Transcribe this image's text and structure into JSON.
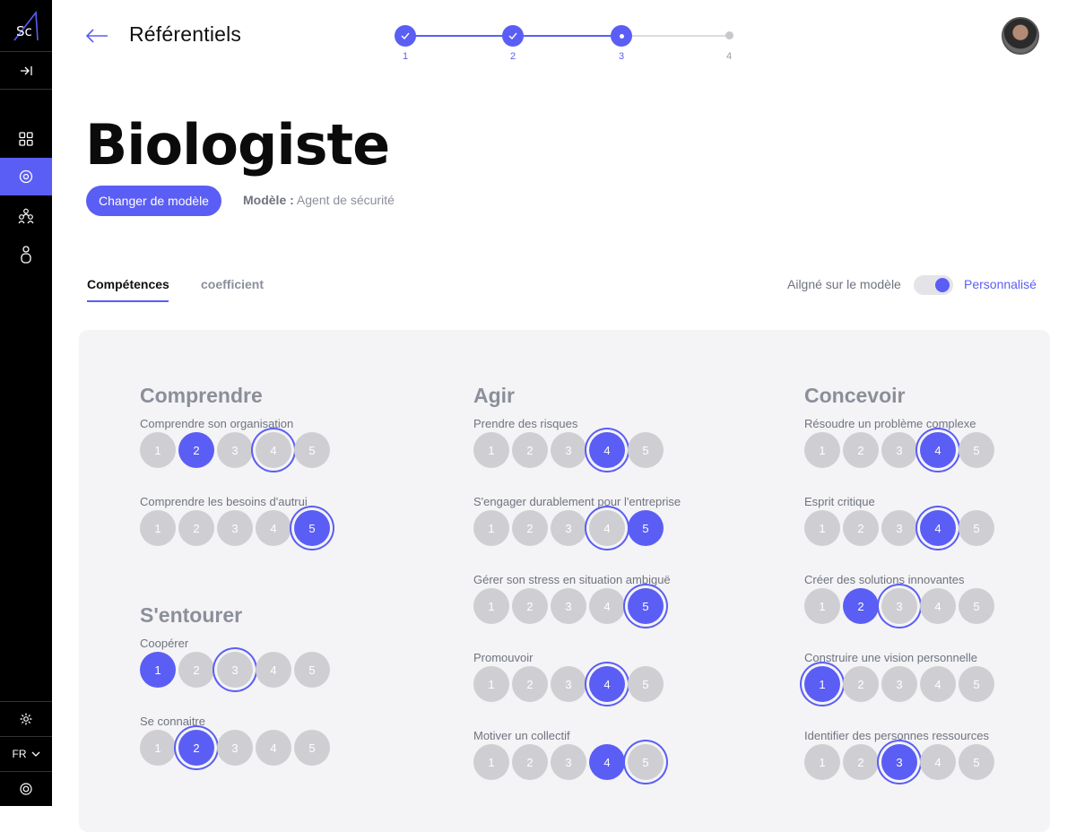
{
  "sidebar": {
    "logo": "Sc",
    "lang": "FR"
  },
  "header": {
    "title": "Référentiels"
  },
  "stepper": {
    "steps": [
      "1",
      "2",
      "3",
      "4"
    ]
  },
  "page": {
    "job_title": "Biologiste",
    "change_button": "Changer de modèle",
    "model_label": "Modèle :",
    "model_value": "Agent de sécurité"
  },
  "tabs": {
    "competences": "Compétences",
    "coefficient": "coefficient"
  },
  "alignment": {
    "left_label": "Ailgné sur le modèle",
    "right_label": "Personnalisé",
    "toggle_on": true
  },
  "colors": {
    "accent": "#5b5ef4",
    "inactive": "#cfcfd3",
    "panel": "#f4f4f6"
  },
  "rating_scale": [
    "1",
    "2",
    "3",
    "4",
    "5"
  ],
  "columns": [
    {
      "title": "Comprendre",
      "skills": [
        {
          "name": "Comprendre son organisation",
          "level": 2,
          "model_level": 4
        },
        {
          "name": "Comprendre les besoins d'autrui",
          "level": 5,
          "model_level": 5
        }
      ]
    },
    {
      "title": "S'entourer",
      "skills": [
        {
          "name": "Coopérer",
          "level": 1,
          "model_level": 3
        },
        {
          "name": "Se connaitre",
          "level": 2,
          "model_level": 2
        }
      ]
    },
    {
      "title": "Agir",
      "skills": [
        {
          "name": "Prendre des risques",
          "level": 4,
          "model_level": 4
        },
        {
          "name": "S'engager durablement pour l'entreprise",
          "level": 5,
          "model_level": 4
        },
        {
          "name": "Gérer son stress en situation ambiguë",
          "level": 5,
          "model_level": 5
        },
        {
          "name": "Promouvoir",
          "level": 4,
          "model_level": 4
        },
        {
          "name": "Motiver un collectif",
          "level": 4,
          "model_level": 5
        }
      ]
    },
    {
      "title": "Concevoir",
      "skills": [
        {
          "name": "Résoudre un problème complexe",
          "level": 4,
          "model_level": 4
        },
        {
          "name": "Esprit critique",
          "level": 4,
          "model_level": 4
        },
        {
          "name": "Créer des solutions innovantes",
          "level": 2,
          "model_level": 3
        },
        {
          "name": "Construire une vision personnelle",
          "level": 1,
          "model_level": 1
        },
        {
          "name": "Identifier des personnes ressources",
          "level": 3,
          "model_level": 3
        }
      ]
    }
  ]
}
